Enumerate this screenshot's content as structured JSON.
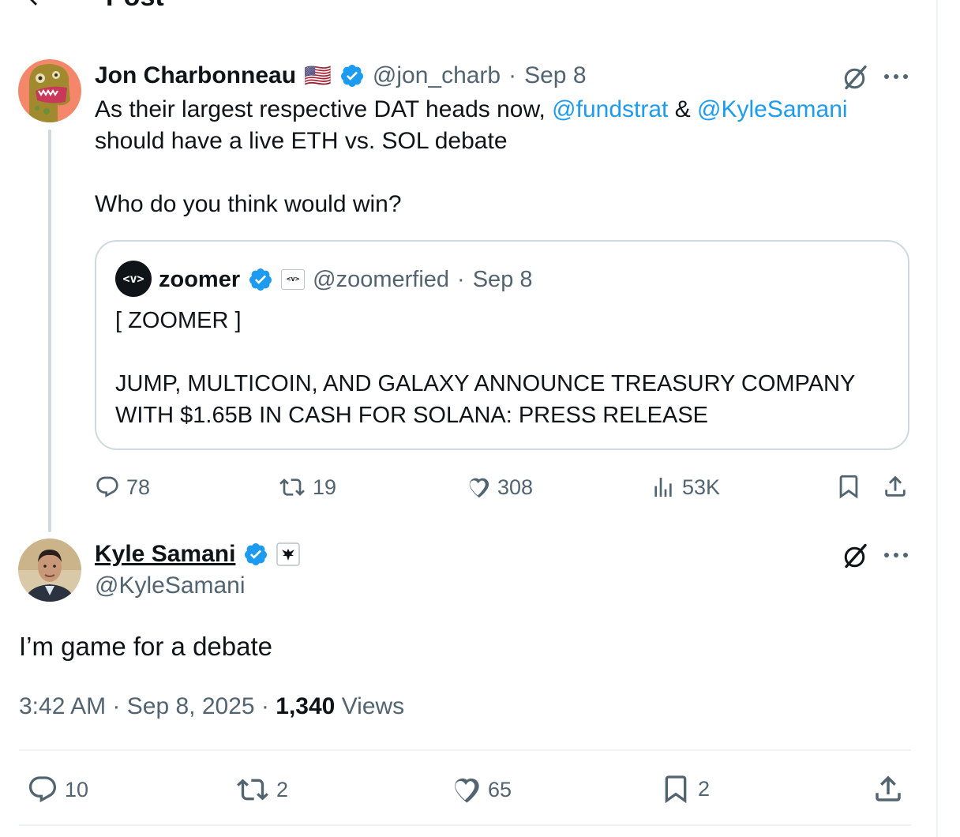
{
  "header": {
    "title": "Post"
  },
  "tweet1": {
    "name": "Jon Charbonneau",
    "flag": "🇺🇸",
    "handle": "@jon_charb",
    "sep": "·",
    "date": "Sep 8",
    "text_pre": "As their largest respective DAT heads now, ",
    "mention1": "@fundstrat",
    "amp": " & ",
    "mention2": "@KyleSamani",
    "text_line2": "should have a live ETH vs. SOL debate",
    "text_line3": "Who do you think would win?",
    "quote": {
      "avatar_text": "<v>",
      "name": "zoomer",
      "badge_text": "<v>",
      "handle": "@zoomerfied",
      "sep": "·",
      "date": "Sep 8",
      "text": "[ ZOOMER ]\n\nJUMP, MULTICOIN, AND GALAXY ANNOUNCE TREASURY COMPANY\nWITH $1.65B IN CASH FOR SOLANA: PRESS RELEASE"
    },
    "actions": {
      "replies": "78",
      "reposts": "19",
      "likes": "308",
      "views": "53K"
    }
  },
  "tweet2": {
    "name": "Kyle Samani",
    "handle": "@KyleSamani",
    "text": "I’m game for a debate",
    "time": "3:42 AM",
    "sep1": "·",
    "date": "Sep 8, 2025",
    "sep2": "·",
    "views_count": "1,340",
    "views_label": "Views",
    "actions": {
      "replies": "10",
      "reposts": "2",
      "likes": "65",
      "bookmarks": "2"
    }
  },
  "colors": {
    "accent": "#1d9bf0",
    "muted": "#536471",
    "text": "#0f1419",
    "border": "#cfd9de"
  },
  "icons": [
    "back-arrow-icon",
    "verified-icon",
    "grok-icon",
    "more-icon",
    "reply-icon",
    "repost-icon",
    "like-icon",
    "views-icon",
    "bookmark-icon",
    "share-icon",
    "affiliate-badge-icon"
  ]
}
